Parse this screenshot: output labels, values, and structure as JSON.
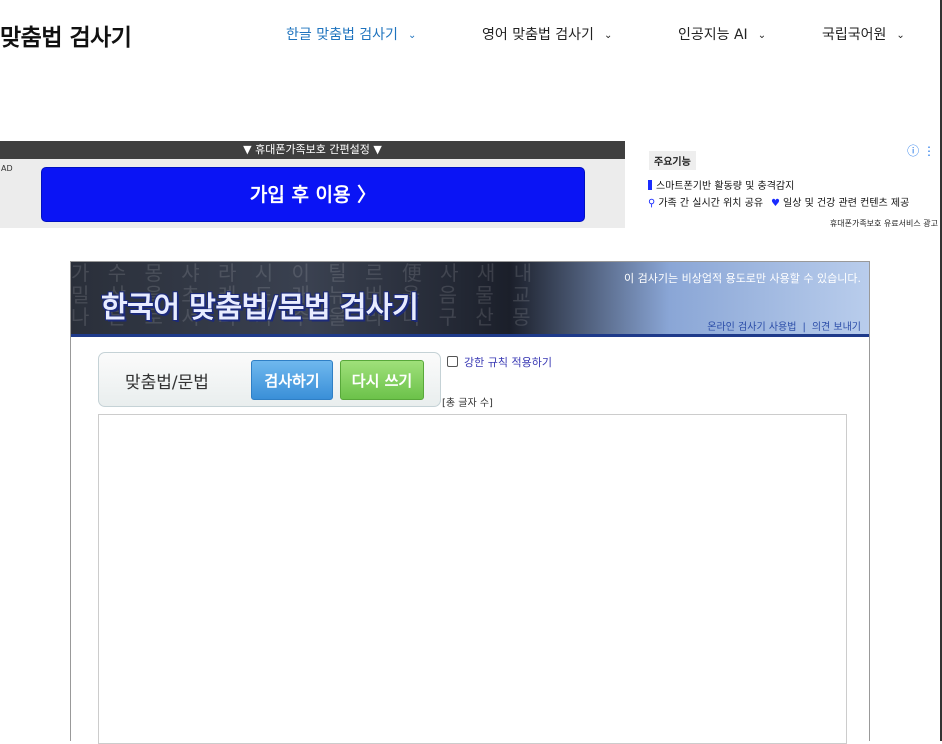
{
  "header": {
    "site_title": "맞춤법 검사기",
    "nav": [
      {
        "label": "한글 맞춤법 검사기",
        "active": true
      },
      {
        "label": "영어 맞춤법 검사기",
        "active": false
      },
      {
        "label": "인공지능 AI",
        "active": false
      },
      {
        "label": "국립국어원",
        "active": false
      }
    ]
  },
  "ad": {
    "top_bar": "▼ 휴대폰가족보호 간편설정 ▼",
    "label": "AD",
    "cta": "가입 후 이용 〉",
    "badge": "주요기능",
    "line1": "스마트폰기반 활동량 및 충격감지",
    "line2a": "가족 간 실시간 위치 공유",
    "line2b": "일상 및 건강 관련 컨텐츠 제공",
    "footer": "휴대폰가족보호 유료서비스 광고",
    "info_icon": "ⓘ ⋮"
  },
  "checker": {
    "banner_title": "한국어 맞춤법/문법 검사기",
    "banner_note": "이 검사기는 비상업적 용도로만 사용할 수 있습니다.",
    "link_usage": "온라인 검사기 사용법",
    "link_feedback": "의견 보내기",
    "mode_label": "맞춤법/문법",
    "check_button": "검사하기",
    "reset_button": "다시 쓰기",
    "strict_label": "강한 규칙 적용하기",
    "char_count": "[총 글자 수]",
    "textarea_value": ""
  },
  "colors": {
    "accent": "#1e73be",
    "ad_cta": "#0a14f5",
    "check_button": "#3a8fd8",
    "reset_button": "#6cc24a"
  }
}
